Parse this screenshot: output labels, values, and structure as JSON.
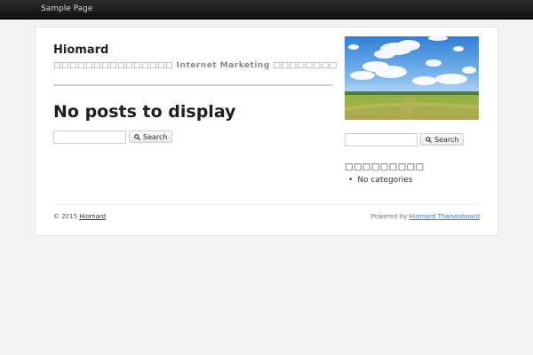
{
  "topbar": {
    "nav_label": "Sample Page"
  },
  "header": {
    "site_title": "Hiomard",
    "tagline": "□□□□□□□□□□□□□□□ Internet Marketing □□□□□□□□□□□□"
  },
  "main": {
    "heading": "No posts to display",
    "search_button": "Search",
    "search_value": ""
  },
  "sidebar": {
    "search_button": "Search",
    "search_value": "",
    "widget_title": "□□□□□□□□□",
    "categories": [
      "No categories"
    ],
    "hero_image": "landscape-field-sky-image"
  },
  "footer": {
    "copyright_prefix": "© 2015",
    "copyright_link": "Hiomard",
    "powered_prefix": "Powered by",
    "powered_link": "Hiomard Thaiseoboard"
  },
  "colors": {
    "topbar": "#1a1a1a",
    "link_blue": "#3a7ab8",
    "background": "#f3f3f3"
  }
}
